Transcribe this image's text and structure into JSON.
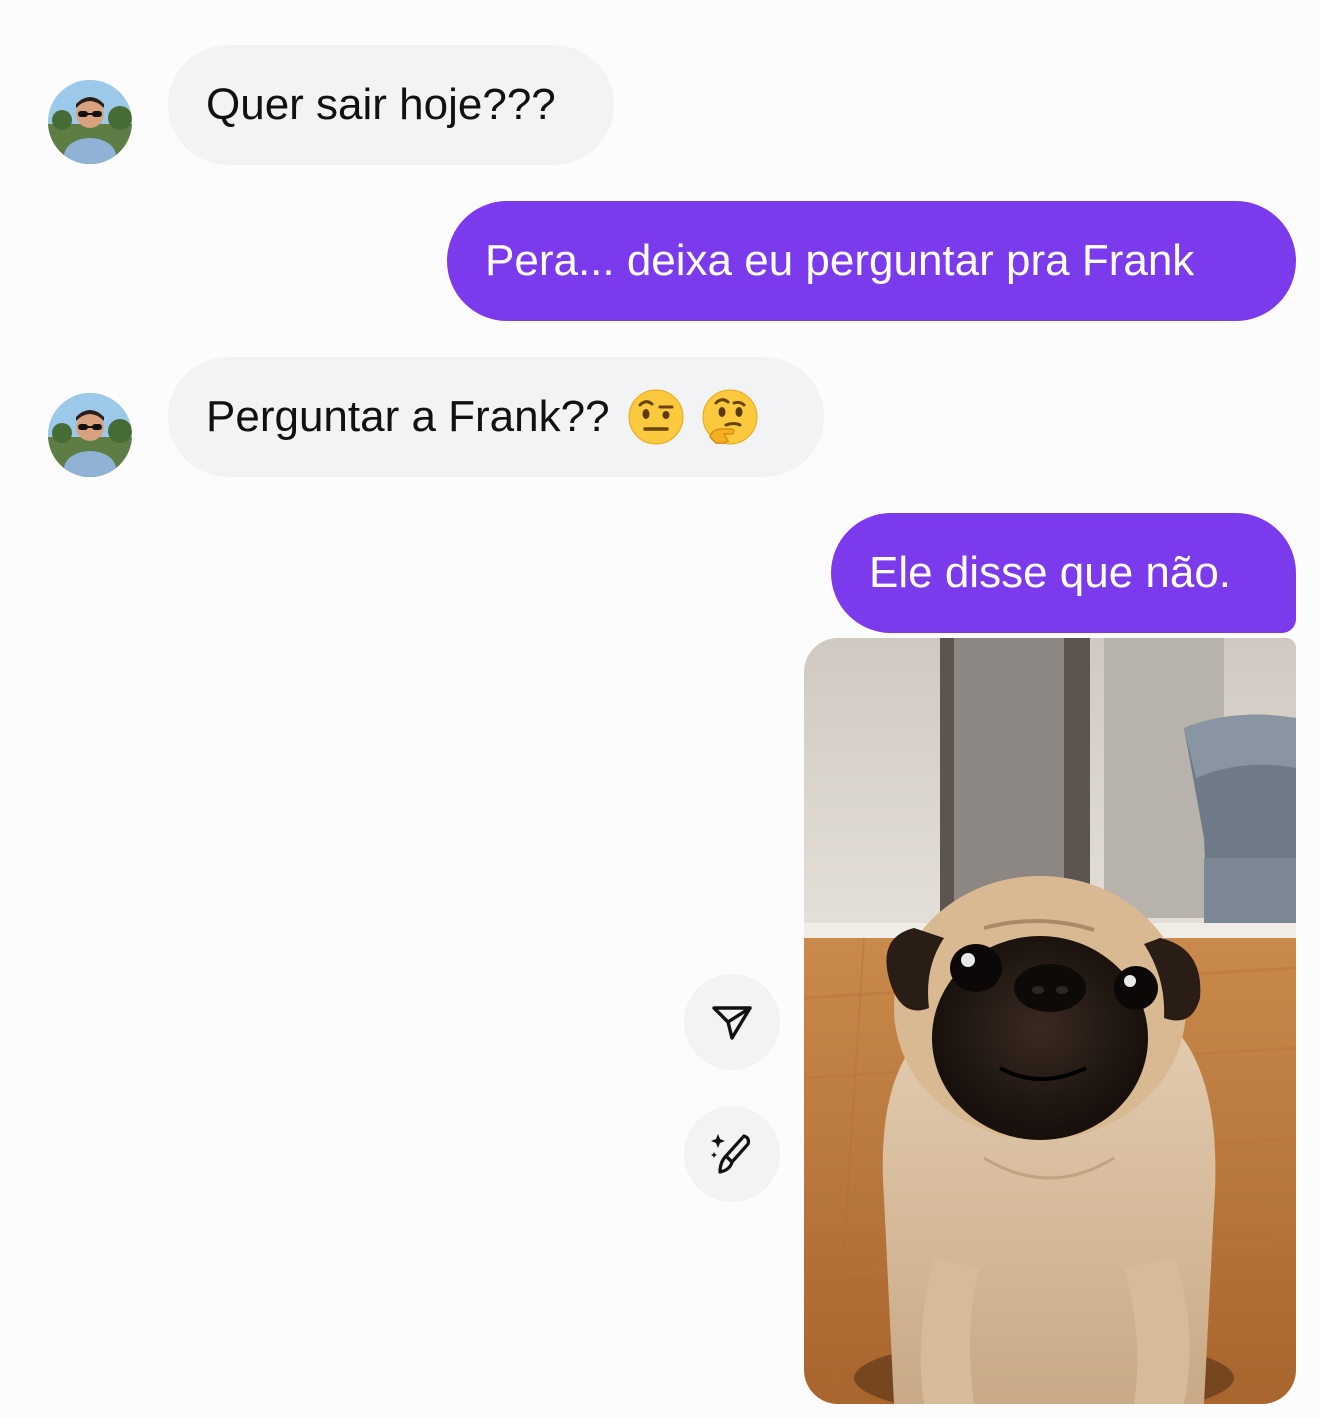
{
  "messages": [
    {
      "direction": "in",
      "text": "Quer sair hoje???"
    },
    {
      "direction": "out",
      "text": "Pera... deixa eu perguntar pra Frank"
    },
    {
      "direction": "in",
      "text": "Perguntar a Frank??",
      "emojis": [
        "face-with-raised-eyebrow",
        "thinking-face"
      ]
    },
    {
      "direction": "out",
      "text": "Ele disse que não."
    },
    {
      "direction": "out",
      "type": "photo",
      "photo_subject": "pug"
    }
  ],
  "actions": {
    "share_icon": "send-icon",
    "edit_icon": "sparkle-brush-icon"
  },
  "colors": {
    "outgoing_bubble": "#7c3aed",
    "incoming_bubble": "#f1f3f4",
    "background": "#fcfcfc"
  }
}
